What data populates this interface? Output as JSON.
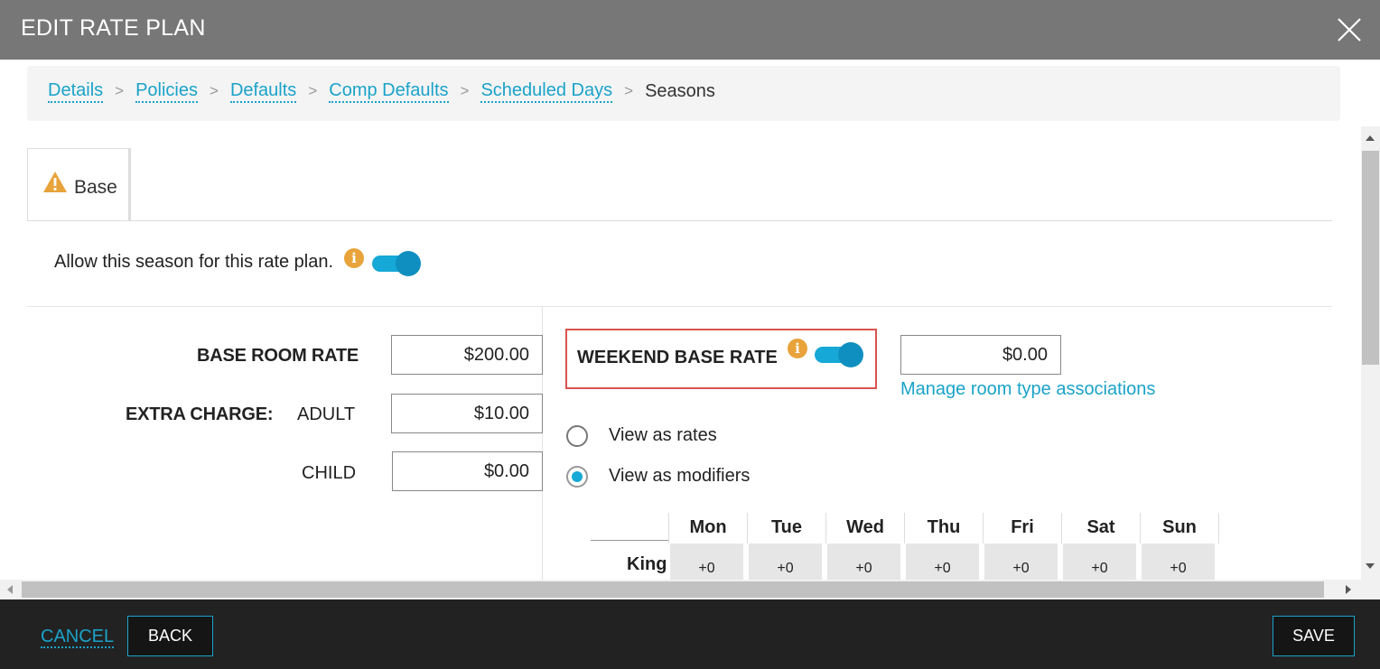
{
  "header": {
    "title": "EDIT RATE PLAN",
    "close_icon": "close-icon"
  },
  "breadcrumb": {
    "items": [
      "Details",
      "Policies",
      "Defaults",
      "Comp Defaults",
      "Scheduled Days"
    ],
    "separator": ">",
    "current": "Seasons"
  },
  "tabs": [
    {
      "label": "Base",
      "icon": "warning-icon"
    }
  ],
  "allow_season": {
    "label": "Allow this season for this rate plan.",
    "enabled": true
  },
  "rates": {
    "base_room_rate_label": "BASE ROOM RATE",
    "base_room_rate": "$200.00",
    "extra_charge_label": "EXTRA CHARGE:",
    "adult_label": "ADULT",
    "adult_value": "$10.00",
    "child_label": "CHILD",
    "child_value": "$0.00"
  },
  "weekend": {
    "label": "WEEKEND BASE RATE",
    "enabled": true,
    "value": "$0.00",
    "manage_link": "Manage room type associations"
  },
  "view_options": {
    "rates": "View as rates",
    "modifiers": "View as modifiers",
    "selected": "modifiers"
  },
  "grid": {
    "days": [
      "Mon",
      "Tue",
      "Wed",
      "Thu",
      "Fri",
      "Sat",
      "Sun"
    ],
    "rows": [
      {
        "label": "King",
        "values": [
          "+0",
          "+0",
          "+0",
          "+0",
          "+0",
          "+0",
          "+0"
        ]
      }
    ]
  },
  "footer": {
    "cancel": "CANCEL",
    "back": "BACK",
    "save": "SAVE"
  },
  "colors": {
    "accent": "#16a8d6",
    "warning": "#e8a33a",
    "highlight": "#d9534f",
    "header_bg": "#777777",
    "footer_bg": "#222222"
  }
}
